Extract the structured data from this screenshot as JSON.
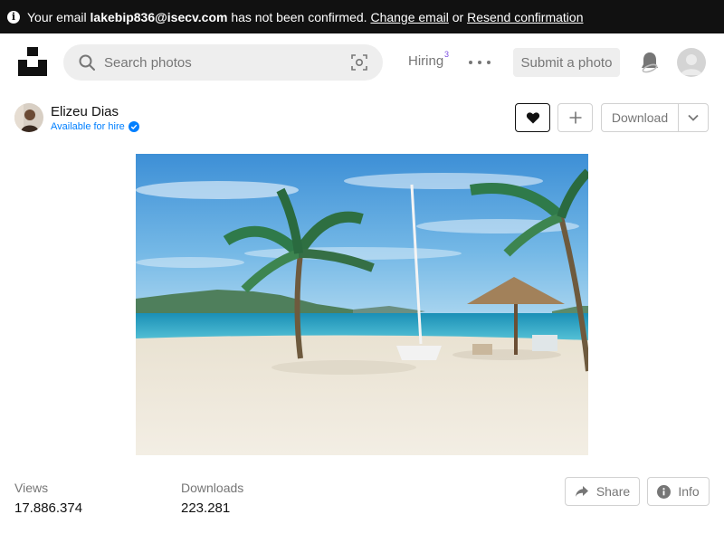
{
  "banner": {
    "prefix": "Your email ",
    "email": "lakebip836@isecv.com",
    "middle": " has not been confirmed. ",
    "change_email": "Change email",
    "or": " or ",
    "resend": "Resend confirmation"
  },
  "header": {
    "search_placeholder": "Search photos",
    "hiring_label": "Hiring",
    "hiring_badge": "3",
    "submit_label": "Submit a photo"
  },
  "author": {
    "name": "Elizeu Dias",
    "hire_label": "Available for hire"
  },
  "actions": {
    "download_label": "Download"
  },
  "stats": {
    "views_label": "Views",
    "views_value": "17.886.374",
    "downloads_label": "Downloads",
    "downloads_value": "223.281"
  },
  "footer_actions": {
    "share_label": "Share",
    "info_label": "Info"
  },
  "icons": [
    "info-icon",
    "unsplash-logo",
    "search-icon",
    "visual-search-icon",
    "more-icon",
    "bell-icon",
    "user-avatar",
    "verified-icon",
    "heart-icon",
    "plus-icon",
    "chevron-down-icon",
    "share-icon",
    "info-circle-icon"
  ],
  "colors": {
    "banner_bg": "#111111",
    "accent_blue": "#007fff",
    "hiring_badge": "#7b4ce0",
    "muted_text": "#767676"
  }
}
